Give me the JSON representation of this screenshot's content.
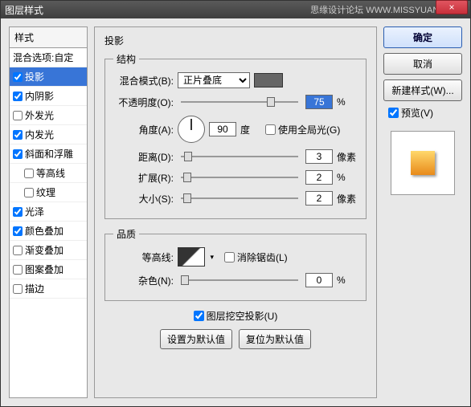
{
  "window": {
    "title": "图层样式",
    "right_text": "思缘设计论坛  WWW.MISSYUAN.COM",
    "close": "×"
  },
  "left": {
    "header": "样式",
    "items": [
      {
        "label": "混合选项:自定",
        "checked": null
      },
      {
        "label": "投影",
        "checked": true,
        "selected": true
      },
      {
        "label": "内阴影",
        "checked": true
      },
      {
        "label": "外发光",
        "checked": false
      },
      {
        "label": "内发光",
        "checked": true
      },
      {
        "label": "斜面和浮雕",
        "checked": true
      },
      {
        "label": "等高线",
        "checked": false,
        "indent": true
      },
      {
        "label": "纹理",
        "checked": false,
        "indent": true
      },
      {
        "label": "光泽",
        "checked": true
      },
      {
        "label": "颜色叠加",
        "checked": true
      },
      {
        "label": "渐变叠加",
        "checked": false
      },
      {
        "label": "图案叠加",
        "checked": false
      },
      {
        "label": "描边",
        "checked": false
      }
    ]
  },
  "middle": {
    "title": "投影",
    "structure": {
      "legend": "结构",
      "blend_mode": {
        "label": "混合模式(B):",
        "value": "正片叠底",
        "color": "#555555"
      },
      "opacity": {
        "label": "不透明度(O):",
        "value": "75",
        "unit": "%",
        "thumb_pct": 73
      },
      "angle": {
        "label": "角度(A):",
        "value": "90",
        "unit": "度",
        "global": {
          "label": "使用全局光(G)",
          "checked": false
        }
      },
      "distance": {
        "label": "距离(D):",
        "value": "3",
        "unit": "像素",
        "thumb_pct": 3
      },
      "spread": {
        "label": "扩展(R):",
        "value": "2",
        "unit": "%",
        "thumb_pct": 2
      },
      "size": {
        "label": "大小(S):",
        "value": "2",
        "unit": "像素",
        "thumb_pct": 2
      }
    },
    "quality": {
      "legend": "品质",
      "contour": {
        "label": "等高线:",
        "antialias": {
          "label": "消除锯齿(L)",
          "checked": false
        }
      },
      "noise": {
        "label": "杂色(N):",
        "value": "0",
        "unit": "%",
        "thumb_pct": 0
      }
    },
    "knockout": {
      "label": "图层挖空投影(U)",
      "checked": true
    },
    "default_btn": "设置为默认值",
    "reset_btn": "复位为默认值"
  },
  "right": {
    "ok": "确定",
    "cancel": "取消",
    "new_style": "新建样式(W)...",
    "preview": {
      "label": "预览(V)",
      "checked": true
    }
  }
}
